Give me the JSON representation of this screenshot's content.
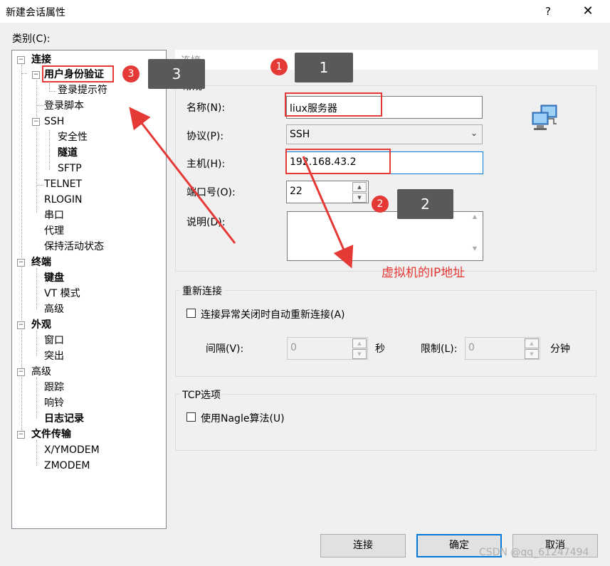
{
  "dialog": {
    "title": "新建会话属性",
    "help": "?",
    "close": "✕"
  },
  "category_label": "类别(C):",
  "tree": [
    {
      "label": "连接",
      "bold": true,
      "exp": "−"
    },
    {
      "label": "用户身份验证",
      "bold": true,
      "exp": "−"
    },
    {
      "label": "登录提示符"
    },
    {
      "label": "登录脚本"
    },
    {
      "label": "SSH",
      "exp": "−"
    },
    {
      "label": "安全性"
    },
    {
      "label": "隧道",
      "bold": true
    },
    {
      "label": "SFTP"
    },
    {
      "label": "TELNET"
    },
    {
      "label": "RLOGIN"
    },
    {
      "label": "串口"
    },
    {
      "label": "代理"
    },
    {
      "label": "保持活动状态"
    },
    {
      "label": "终端",
      "bold": true,
      "exp": "−"
    },
    {
      "label": "键盘",
      "bold": true
    },
    {
      "label": "VT 模式"
    },
    {
      "label": "高级"
    },
    {
      "label": "外观",
      "bold": true,
      "exp": "−"
    },
    {
      "label": "窗口"
    },
    {
      "label": "突出"
    },
    {
      "label": "高级",
      "exp": "−"
    },
    {
      "label": "跟踪"
    },
    {
      "label": "响铃"
    },
    {
      "label": "日志记录",
      "bold": true
    },
    {
      "label": "文件传输",
      "bold": true,
      "exp": "−"
    },
    {
      "label": "X/YMODEM"
    },
    {
      "label": "ZMODEM"
    }
  ],
  "panel": {
    "header": "连接",
    "general": {
      "title": "常规",
      "name_label": "名称(N):",
      "name_value": "liux服务器",
      "protocol_label": "协议(P):",
      "protocol_value": "SSH",
      "host_label": "主机(H):",
      "host_value": "192.168.43.2",
      "port_label": "端口号(O):",
      "port_value": "22",
      "desc_label": "说明(D):",
      "desc_value": ""
    },
    "reconnect": {
      "title": "重新连接",
      "checkbox_label": "连接异常关闭时自动重新连接(A)",
      "interval_label": "间隔(V):",
      "interval_value": "0",
      "interval_unit": "秒",
      "limit_label": "限制(L):",
      "limit_value": "0",
      "limit_unit": "分钟"
    },
    "tcp": {
      "title": "TCP选项",
      "nagle_label": "使用Nagle算法(U)"
    }
  },
  "buttons": {
    "connect": "连接",
    "ok": "确定",
    "cancel": "取消"
  },
  "annotations": {
    "callout1": "1",
    "badge1": "1",
    "callout2": "2",
    "badge2": "2",
    "callout3": "3",
    "badge3": "3",
    "ip_note": "虚拟机的IP地址",
    "color": "#e53935"
  },
  "watermark": "CSDN @qq_61247494"
}
